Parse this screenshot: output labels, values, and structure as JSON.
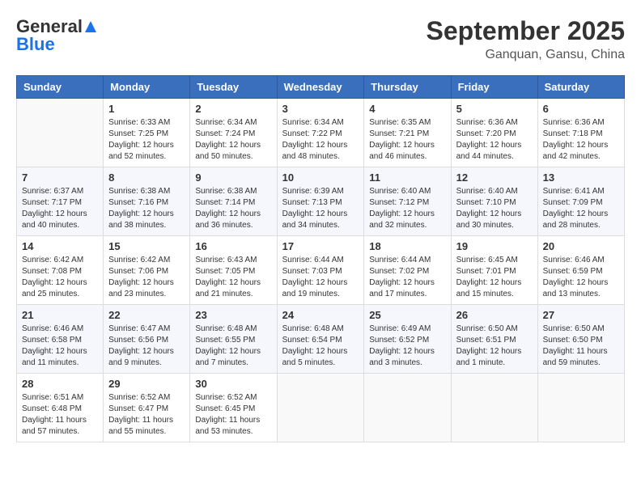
{
  "header": {
    "logo_general": "General",
    "logo_blue": "Blue",
    "month": "September 2025",
    "location": "Ganquan, Gansu, China"
  },
  "days_of_week": [
    "Sunday",
    "Monday",
    "Tuesday",
    "Wednesday",
    "Thursday",
    "Friday",
    "Saturday"
  ],
  "weeks": [
    [
      {
        "day": "",
        "info": ""
      },
      {
        "day": "1",
        "info": "Sunrise: 6:33 AM\nSunset: 7:25 PM\nDaylight: 12 hours\nand 52 minutes."
      },
      {
        "day": "2",
        "info": "Sunrise: 6:34 AM\nSunset: 7:24 PM\nDaylight: 12 hours\nand 50 minutes."
      },
      {
        "day": "3",
        "info": "Sunrise: 6:34 AM\nSunset: 7:22 PM\nDaylight: 12 hours\nand 48 minutes."
      },
      {
        "day": "4",
        "info": "Sunrise: 6:35 AM\nSunset: 7:21 PM\nDaylight: 12 hours\nand 46 minutes."
      },
      {
        "day": "5",
        "info": "Sunrise: 6:36 AM\nSunset: 7:20 PM\nDaylight: 12 hours\nand 44 minutes."
      },
      {
        "day": "6",
        "info": "Sunrise: 6:36 AM\nSunset: 7:18 PM\nDaylight: 12 hours\nand 42 minutes."
      }
    ],
    [
      {
        "day": "7",
        "info": "Sunrise: 6:37 AM\nSunset: 7:17 PM\nDaylight: 12 hours\nand 40 minutes."
      },
      {
        "day": "8",
        "info": "Sunrise: 6:38 AM\nSunset: 7:16 PM\nDaylight: 12 hours\nand 38 minutes."
      },
      {
        "day": "9",
        "info": "Sunrise: 6:38 AM\nSunset: 7:14 PM\nDaylight: 12 hours\nand 36 minutes."
      },
      {
        "day": "10",
        "info": "Sunrise: 6:39 AM\nSunset: 7:13 PM\nDaylight: 12 hours\nand 34 minutes."
      },
      {
        "day": "11",
        "info": "Sunrise: 6:40 AM\nSunset: 7:12 PM\nDaylight: 12 hours\nand 32 minutes."
      },
      {
        "day": "12",
        "info": "Sunrise: 6:40 AM\nSunset: 7:10 PM\nDaylight: 12 hours\nand 30 minutes."
      },
      {
        "day": "13",
        "info": "Sunrise: 6:41 AM\nSunset: 7:09 PM\nDaylight: 12 hours\nand 28 minutes."
      }
    ],
    [
      {
        "day": "14",
        "info": "Sunrise: 6:42 AM\nSunset: 7:08 PM\nDaylight: 12 hours\nand 25 minutes."
      },
      {
        "day": "15",
        "info": "Sunrise: 6:42 AM\nSunset: 7:06 PM\nDaylight: 12 hours\nand 23 minutes."
      },
      {
        "day": "16",
        "info": "Sunrise: 6:43 AM\nSunset: 7:05 PM\nDaylight: 12 hours\nand 21 minutes."
      },
      {
        "day": "17",
        "info": "Sunrise: 6:44 AM\nSunset: 7:03 PM\nDaylight: 12 hours\nand 19 minutes."
      },
      {
        "day": "18",
        "info": "Sunrise: 6:44 AM\nSunset: 7:02 PM\nDaylight: 12 hours\nand 17 minutes."
      },
      {
        "day": "19",
        "info": "Sunrise: 6:45 AM\nSunset: 7:01 PM\nDaylight: 12 hours\nand 15 minutes."
      },
      {
        "day": "20",
        "info": "Sunrise: 6:46 AM\nSunset: 6:59 PM\nDaylight: 12 hours\nand 13 minutes."
      }
    ],
    [
      {
        "day": "21",
        "info": "Sunrise: 6:46 AM\nSunset: 6:58 PM\nDaylight: 12 hours\nand 11 minutes."
      },
      {
        "day": "22",
        "info": "Sunrise: 6:47 AM\nSunset: 6:56 PM\nDaylight: 12 hours\nand 9 minutes."
      },
      {
        "day": "23",
        "info": "Sunrise: 6:48 AM\nSunset: 6:55 PM\nDaylight: 12 hours\nand 7 minutes."
      },
      {
        "day": "24",
        "info": "Sunrise: 6:48 AM\nSunset: 6:54 PM\nDaylight: 12 hours\nand 5 minutes."
      },
      {
        "day": "25",
        "info": "Sunrise: 6:49 AM\nSunset: 6:52 PM\nDaylight: 12 hours\nand 3 minutes."
      },
      {
        "day": "26",
        "info": "Sunrise: 6:50 AM\nSunset: 6:51 PM\nDaylight: 12 hours\nand 1 minute."
      },
      {
        "day": "27",
        "info": "Sunrise: 6:50 AM\nSunset: 6:50 PM\nDaylight: 11 hours\nand 59 minutes."
      }
    ],
    [
      {
        "day": "28",
        "info": "Sunrise: 6:51 AM\nSunset: 6:48 PM\nDaylight: 11 hours\nand 57 minutes."
      },
      {
        "day": "29",
        "info": "Sunrise: 6:52 AM\nSunset: 6:47 PM\nDaylight: 11 hours\nand 55 minutes."
      },
      {
        "day": "30",
        "info": "Sunrise: 6:52 AM\nSunset: 6:45 PM\nDaylight: 11 hours\nand 53 minutes."
      },
      {
        "day": "",
        "info": ""
      },
      {
        "day": "",
        "info": ""
      },
      {
        "day": "",
        "info": ""
      },
      {
        "day": "",
        "info": ""
      }
    ]
  ]
}
